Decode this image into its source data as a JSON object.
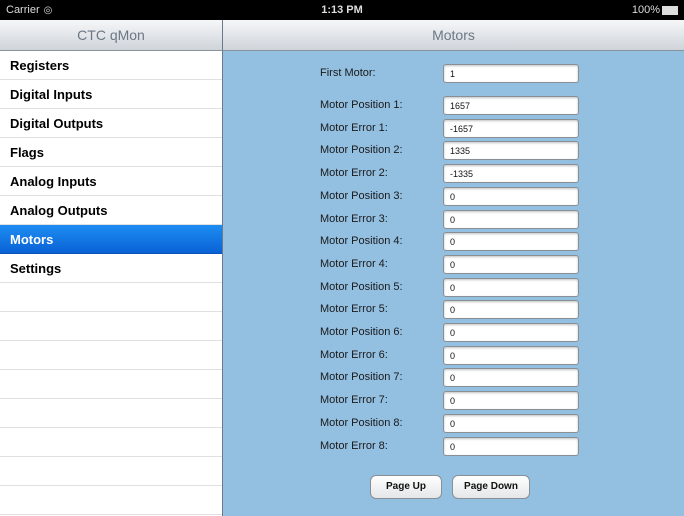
{
  "status_bar": {
    "carrier": "Carrier",
    "time": "1:13 PM",
    "battery": "100%"
  },
  "master": {
    "title": "CTC qMon",
    "items": [
      {
        "label": "Registers",
        "selected": false
      },
      {
        "label": "Digital Inputs",
        "selected": false
      },
      {
        "label": "Digital Outputs",
        "selected": false
      },
      {
        "label": "Flags",
        "selected": false
      },
      {
        "label": "Analog Inputs",
        "selected": false
      },
      {
        "label": "Analog Outputs",
        "selected": false
      },
      {
        "label": "Motors",
        "selected": true
      },
      {
        "label": "Settings",
        "selected": false
      }
    ]
  },
  "detail": {
    "title": "Motors",
    "first_motor": {
      "label": "First Motor:",
      "value": "1"
    },
    "fields": [
      {
        "label": "Motor Position 1:",
        "value": "1657"
      },
      {
        "label": "Motor Error 1:",
        "value": "-1657"
      },
      {
        "label": "Motor Position 2:",
        "value": "1335"
      },
      {
        "label": "Motor Error 2:",
        "value": "-1335"
      },
      {
        "label": "Motor Position 3:",
        "value": "0"
      },
      {
        "label": "Motor Error 3:",
        "value": "0"
      },
      {
        "label": "Motor Position 4:",
        "value": "0"
      },
      {
        "label": "Motor Error 4:",
        "value": "0"
      },
      {
        "label": "Motor Position 5:",
        "value": "0"
      },
      {
        "label": "Motor Error 5:",
        "value": "0"
      },
      {
        "label": "Motor Position 6:",
        "value": "0"
      },
      {
        "label": "Motor Error 6:",
        "value": "0"
      },
      {
        "label": "Motor Position 7:",
        "value": "0"
      },
      {
        "label": "Motor Error 7:",
        "value": "0"
      },
      {
        "label": "Motor Position 8:",
        "value": "0"
      },
      {
        "label": "Motor Error 8:",
        "value": "0"
      }
    ],
    "page_up_label": "Page Up",
    "page_down_label": "Page Down"
  }
}
